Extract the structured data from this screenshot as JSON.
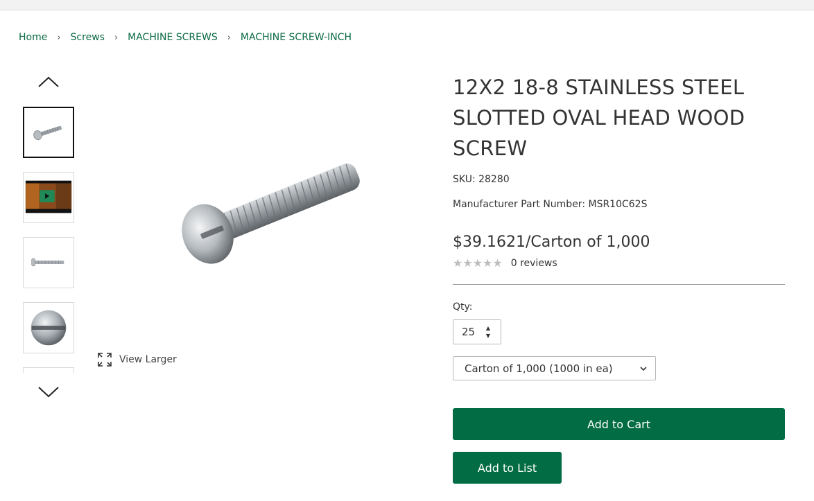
{
  "breadcrumb": {
    "items": [
      "Home",
      "Screws",
      "MACHINE SCREWS",
      "MACHINE SCREW-INCH"
    ],
    "separator": "›"
  },
  "gallery": {
    "view_larger_label": "View Larger",
    "thumbnails": [
      "screw-thumbnail",
      "video-thumbnail",
      "screw-side-thumbnail",
      "screw-head-thumbnail"
    ]
  },
  "product": {
    "title": "12X2 18-8 STAINLESS STEEL SLOTTED OVAL HEAD WOOD SCREW",
    "sku": "SKU: 28280",
    "mpn": "Manufacturer Part Number: MSR10C62S",
    "price": "$39.1621/Carton of 1,000",
    "stars": "★★★★★",
    "reviews": "0 reviews"
  },
  "purchase": {
    "qty_label": "Qty:",
    "qty_value": "25",
    "uom_selected": "Carton of 1,000 (1000 in ea)",
    "add_to_cart_label": "Add to Cart",
    "add_to_list_label": "Add to List"
  },
  "colors": {
    "brand_green": "#026c44",
    "link_green": "#0b6b45"
  }
}
